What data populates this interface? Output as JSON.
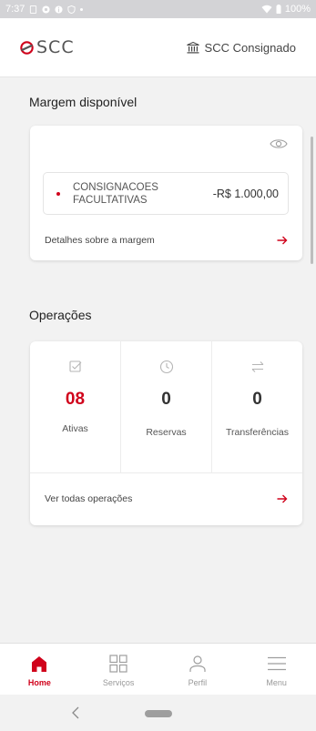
{
  "status_bar": {
    "time": "7:37",
    "battery": "100%"
  },
  "header": {
    "logo_text": "SCC",
    "account_label": "SCC Consignado",
    "brand_color": "#d0021b"
  },
  "margin_section": {
    "title": "Margem disponível",
    "rows": [
      {
        "label": "CONSIGNACOES FACULTATIVAS",
        "value": "-R$ 1.000,00"
      }
    ],
    "details_link": "Detalhes sobre a margem",
    "arrow": "→"
  },
  "operations": {
    "title": "Operações",
    "stats": [
      {
        "icon": "checkbox-icon",
        "value": "08",
        "label": "Ativas"
      },
      {
        "icon": "clock-icon",
        "value": "0",
        "label": "Reservas"
      },
      {
        "icon": "transfer-icon",
        "value": "0",
        "label": "Transferências"
      }
    ],
    "see_all_link": "Ver todas operações",
    "arrow": "→"
  },
  "bottom_nav": {
    "items": [
      {
        "label": "Home",
        "icon": "home-icon",
        "active": true
      },
      {
        "label": "Serviços",
        "icon": "grid-icon",
        "active": false
      },
      {
        "label": "Perfil",
        "icon": "person-icon",
        "active": false
      },
      {
        "label": "Menu",
        "icon": "menu-icon",
        "active": false
      }
    ]
  }
}
